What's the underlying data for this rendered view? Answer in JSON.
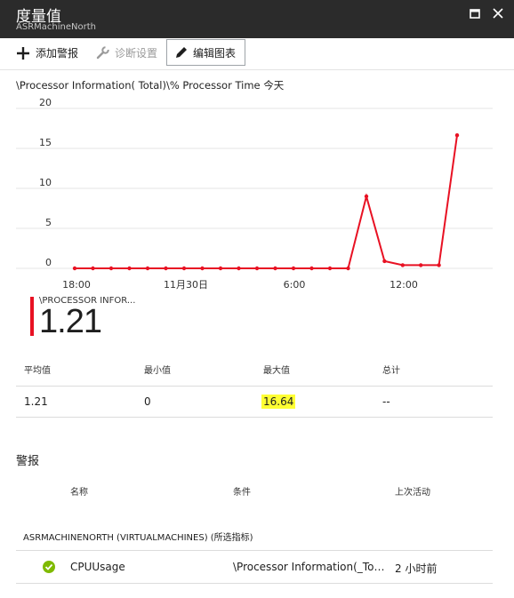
{
  "header": {
    "title": "度量值",
    "subtitle": "ASRMachineNorth"
  },
  "toolbar": {
    "add_alert": "添加警报",
    "diagnostics": "诊断设置",
    "edit_chart": "编辑图表"
  },
  "chart_header": "\\Processor Information( Total)\\% Processor Time 今天",
  "chart_data": {
    "type": "line",
    "title": "",
    "y_ticks": [
      "20",
      "15",
      "10",
      "5",
      "0"
    ],
    "x_ticks": [
      "18:00",
      "11月30日",
      "6:00",
      "12:00"
    ],
    "ylim": [
      0,
      20
    ],
    "grid": true,
    "series": [
      {
        "name": "\\PROCESSOR INFORMATION",
        "color": "#e81123",
        "values": [
          0,
          0,
          0,
          0,
          0,
          0,
          0,
          0,
          0,
          0,
          0,
          0,
          0,
          0,
          0,
          0,
          9.0,
          0.9,
          0.4,
          0.4,
          0.4,
          16.64
        ]
      }
    ]
  },
  "summary": {
    "series_label": "\\PROCESSOR INFOR...",
    "value": "1.21"
  },
  "stats": {
    "avg_label": "平均值",
    "min_label": "最小值",
    "max_label": "最大值",
    "total_label": "总计",
    "avg": "1.21",
    "min": "0",
    "max": "16.64",
    "total": "--"
  },
  "alerts": {
    "title": "警报",
    "col_name": "名称",
    "col_condition": "条件",
    "col_last": "上次活动",
    "group": "ASRMACHINENORTH (VIRTUALMACHINES) (所选指标)",
    "rows": [
      {
        "name": "CPUUsage",
        "condition": "\\Processor Information(_Tot...",
        "last": "2 小时前"
      }
    ]
  }
}
